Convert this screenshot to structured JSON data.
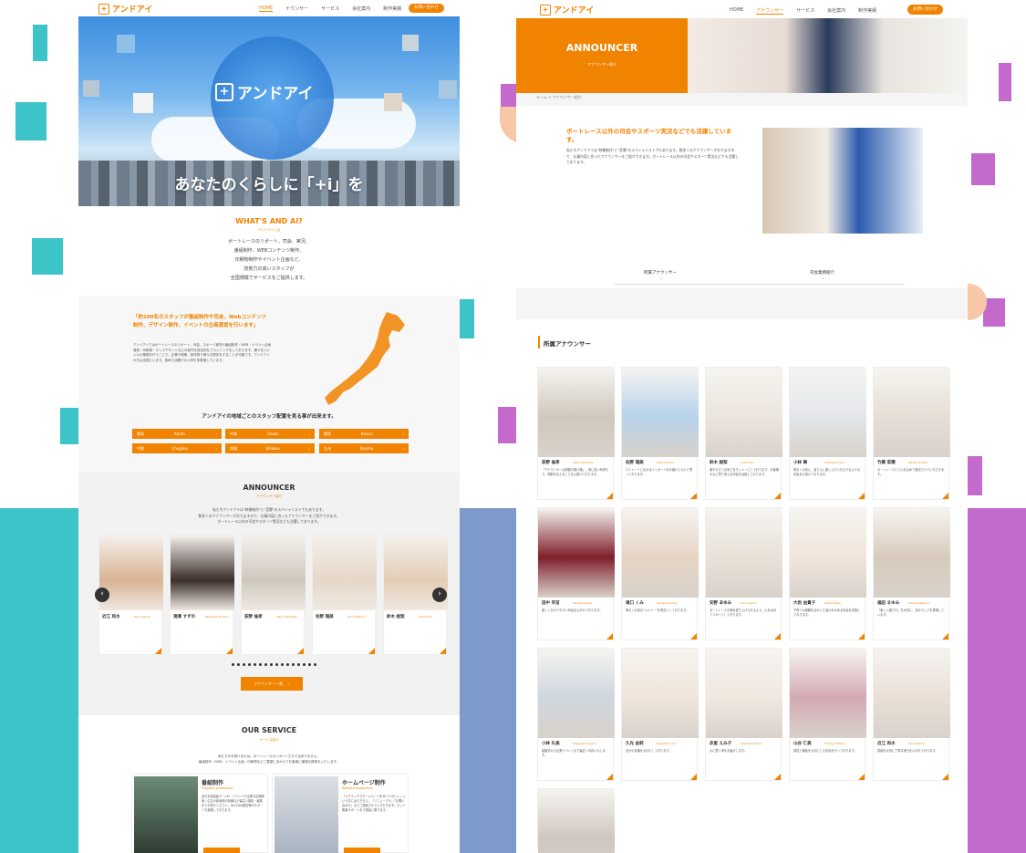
{
  "colors": {
    "teal": "#3cc4c8",
    "purple": "#c46acd",
    "blue": "#7d9acb",
    "brand_orange": "#f08300",
    "peach": "#f8c7a7"
  },
  "left": {
    "logo_text": "アンドアイ",
    "nav": [
      "HOME",
      "ナウンサー",
      "サービス",
      "会社案内",
      "制作実績"
    ],
    "contact": "お問い合わせ",
    "hero_tagline": "あなたのくらしに「+i」を",
    "hero_logo_text": "アンドアイ",
    "whats_title": "WHAT'S AND AI?",
    "whats_sub": "アンドアイとは",
    "whats_body": [
      "ボートレースのリポート、司会、実況、",
      "番組制作、WEBコンテンツ制作、",
      "印刷物制作やイベント企画など、",
      "技術力の高いスタッフが",
      "全国規模でサービスをご提供します。"
    ],
    "staff_heading": "「約100名のスタッフが番組制作や司会、Webコンテンツ制作、デザイン制作、イベントの企画運営を行います」",
    "staff_body": "アンドアイではボートレースのリポート、司会、スポーツ実況や番組制作・WEB・イベント企画運営・印刷物・グッズデザインなどの制作を総合的なプランニングをしております。様々なジャンルの業務を行うことで、企業や映像、制作物で様々な提供をすることが可能です。アンドアイの方は全国にいます。各地で活躍する人材を多数擁しています。",
    "region_heading": "アンドアイの地域ごとのスタッフ配置を見る事が出来ます。",
    "regions": [
      {
        "jp": "関東",
        "en": "Kanto"
      },
      {
        "jp": "中部",
        "en": "Chubu"
      },
      {
        "jp": "関西",
        "en": "Kansai"
      },
      {
        "jp": "中国",
        "en": "Chugoku"
      },
      {
        "jp": "四国",
        "en": "Shikoku"
      },
      {
        "jp": "九州",
        "en": "Kyushu"
      }
    ],
    "announcer_title": "ANNOUNCER",
    "announcer_sub": "アナウンサー紹介",
    "announcer_body": [
      "私たちアンドアイは\"映像制作\"と\"音響\"のスペシャリストでもあります。",
      "数多くのアナウンサーがおりますので、仕事内容に合ったアナウンサーをご紹介できます。",
      "ボートレース以外の司会やスポーツ実況なども活躍しております。"
    ],
    "announcers": [
      {
        "name": "近江 和水",
        "en": "Omi Kazumi"
      },
      {
        "name": "滝澤 すずの",
        "en": "Takizawa Suzuno"
      },
      {
        "name": "荻野 倫孝",
        "en": "Ogino Noritaka"
      },
      {
        "name": "佐野 瑞美",
        "en": "Sano Mizumi"
      },
      {
        "name": "鈴木 絵梨",
        "en": "Suzuki Eri"
      }
    ],
    "announcer_list_btn": "アナウンサー一覧",
    "service_title": "OUR SERVICE",
    "service_sub": "サービス紹介",
    "service_body": [
      "私たちが手掛けるのは、ボートレースのリポートだけではありません。",
      "番組制作・WEB・イベント企画・印刷物などご要望にあわせてお客様に最適な提案をいたします。"
    ],
    "services": [
      {
        "title": "番組制作",
        "en": "Program production",
        "desc": "全社を製品紹介・CM・イベントや企業の記録映像・広島の各地域の特番など幅広い撮影・編集までお任せください。YouTube配信等のサポートも実施しております。"
      },
      {
        "title": "ホームページ制作",
        "en": "Website production",
        "desc": "「スクラッチでホームページを作ってほしい」という方にはもちろん、「リニューアル」「お問い合わせ」などご提案させていただきます。ネット集客サポートまで相談に乗ります。"
      }
    ]
  },
  "right": {
    "logo_text": "アンドアイ",
    "nav": [
      "HOME",
      "アナウンサー",
      "サービス",
      "会社案内",
      "制作実績"
    ],
    "contact": "お問い合わせ",
    "page_title": "ANNOUNCER",
    "page_sub": "アナウンサー紹介",
    "breadcrumb": "ホーム > アナウンサー紹介",
    "intro_heading": "ボートレース以外の司会やスポーツ実況などでも活躍しています。",
    "intro_body": "私たちアンドアイは\"映像制作\"と\"音響\"のスペシャリストでもあります。数多くのアナウンサーがおりますので、仕事内容に合ったアナウンサーをご紹介できます。ボートレース以外の司会やスポーツ実況などでも活躍しております。",
    "tabs": [
      "所属アナウンサー",
      "司会業務紹介"
    ],
    "list_heading": "所属アナウンサー",
    "announcers": [
      {
        "name": "荻野 倫孝",
        "en": "Ogino Noritaka",
        "desc": "「アナウンサーは感動の架け橋」。常に熱い気持ちで、感動を伝えることを心掛けております。"
      },
      {
        "name": "佐野 瑞美",
        "en": "Sano Mizumi",
        "desc": "ストレートに伝わるメッセージをお届けしたいと思っております。"
      },
      {
        "name": "鈴木 絵梨",
        "en": "Suzuki Eri",
        "desc": "爽やかさと元気さをモットーにしております。お客様の心に寄り添える司会を目指しております。"
      },
      {
        "name": "小林 舞",
        "en": "Kobayashi Mai",
        "desc": "明るく元気に、皆さんに楽しんでいただけるような司会を心掛けております。"
      },
      {
        "name": "竹蔵 菜穂",
        "en": "Takekura Naho",
        "desc": "ボートレースにて心を込めて実況させていただきます。"
      },
      {
        "name": "田中 早苗",
        "en": "Tanaka Sanae",
        "desc": "楽しく分かりやすい司会を心がけております。"
      },
      {
        "name": "滝口 くみ",
        "en": "Takiguchi Kumi",
        "desc": "明るく元気な\"ヘルシー\"を得意としております。"
      },
      {
        "name": "安野 あゆみ",
        "en": "Anno Ayumi",
        "desc": "ボートレースの場を盛り上げられるよう、心を込めてリポートしております。"
      },
      {
        "name": "大岩 由貴子",
        "en": "Oiwa Yukiko",
        "desc": "子育ての経験を活かした温かみのある司会を目指しております。"
      },
      {
        "name": "福田 まゆみ",
        "en": "Fukuda Mayumi",
        "desc": "「楽しい語り口」を大切に、自分らしさを表現しています。"
      },
      {
        "name": "小林 礼美",
        "en": "Kobayashi Ayami",
        "desc": "結婚式から企業イベントまで幅広く対応いたします。"
      },
      {
        "name": "久光 由莉",
        "en": "Hisamitsu Yuri",
        "desc": "自分の言葉を大切にしております。"
      },
      {
        "name": "赤星 えみ子",
        "en": "Akahoshi Emiko",
        "desc": "心に響く声をお届けします。"
      },
      {
        "name": "山谷 仁美",
        "en": "Yamaya Hitomi",
        "desc": "感性と機転を大切にした司会を行っております。"
      },
      {
        "name": "近江 和水",
        "en": "Omi Kazumi",
        "desc": "笑顔を大切に丁寧な進行を心がけております。"
      },
      {
        "name": "",
        "en": "",
        "desc": ""
      }
    ]
  }
}
